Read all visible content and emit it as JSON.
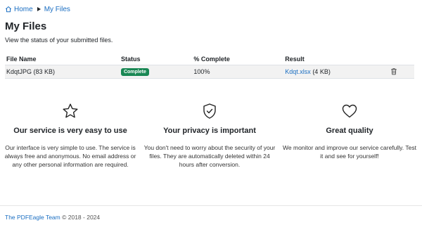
{
  "breadcrumb": {
    "home": "Home",
    "current": "My Files"
  },
  "page": {
    "title": "My Files",
    "subtitle": "View the status of your submitted files."
  },
  "table": {
    "headers": [
      "File Name",
      "Status",
      "% Complete",
      "Result"
    ],
    "rows": [
      {
        "file_name": "KdqtJPG (83 KB)",
        "status": "Complete",
        "percent": "100%",
        "result_link": "Kdqt.xlsx",
        "result_size": "(4 KB)"
      }
    ]
  },
  "features": [
    {
      "icon": "star-icon",
      "title": "Our service is very easy to use",
      "text": "Our interface is very simple to use. The service is always free and anonymous. No email address or any other personal information are required."
    },
    {
      "icon": "shield-check-icon",
      "title": "Your privacy is important",
      "text": "You don't need to worry about the security of your files. They are automatically deleted within 24 hours after conversion."
    },
    {
      "icon": "heart-icon",
      "title": "Great quality",
      "text": "We monitor and improve our service carefully. Test it and see for yourself!"
    }
  ],
  "footer": {
    "team": "The PDFEagle Team",
    "copyright": "© 2018 - 2024"
  },
  "colors": {
    "link": "#1a6ec2",
    "badge": "#198754",
    "row_bg": "#f2f2f2"
  }
}
